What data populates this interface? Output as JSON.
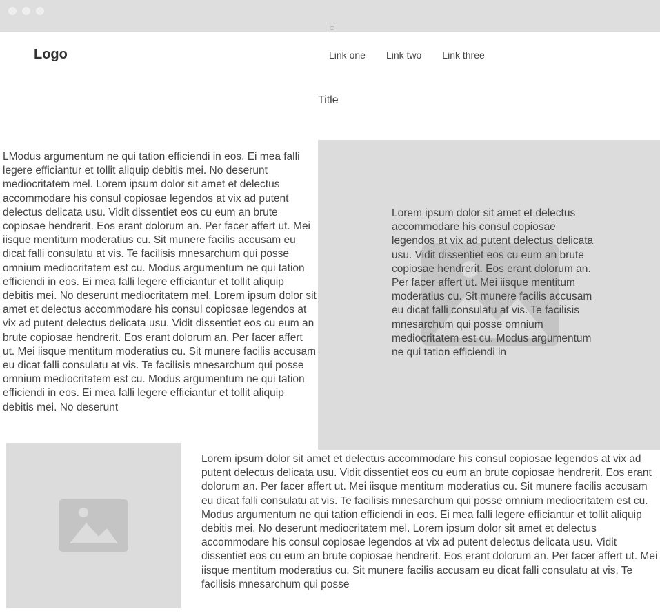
{
  "header": {
    "logo": "Logo",
    "nav": [
      "Link one",
      "Link two",
      "Link three"
    ]
  },
  "main": {
    "title": "Title",
    "left_text": "LModus argumentum ne qui tation efficiendi in eos. Ei mea falli legere efficiantur et tollit aliquip debitis mei. No deserunt mediocritatem mel. Lorem ipsum dolor sit amet et delectus accommodare his consul copiosae legendos at vix ad putent delectus delicata usu. Vidit dissentiet eos cu eum an brute copiosae hendrerit. Eos erant dolorum an. Per facer affert ut. Mei iisque mentitum moderatius cu. Sit munere facilis accusam eu dicat falli consulatu at vis. Te facilisis mnesarchum qui posse omnium mediocritatem est cu. Modus argumentum ne qui tation efficiendi in eos. Ei mea falli legere efficiantur et tollit aliquip debitis mei. No deserunt mediocritatem mel. Lorem ipsum dolor sit amet et delectus accommodare his consul copiosae legendos at vix ad putent delectus delicata usu. Vidit dissentiet eos cu eum an brute copiosae hendrerit. Eos erant dolorum an. Per facer affert ut. Mei iisque mentitum moderatius cu. Sit munere facilis accusam eu dicat falli consulatu at vis. Te facilisis mnesarchum qui posse omnium mediocritatem est cu. Modus argumentum ne qui tation efficiendi in eos. Ei mea falli legere efficiantur et tollit aliquip debitis mei. No deserunt",
    "panel_text": "Lorem ipsum dolor sit amet et delectus accommodare his consul copiosae legendos at vix ad putent delectus delicata usu. Vidit dissentiet eos cu eum an brute copiosae hendrerit. Eos erant dolorum an. Per facer affert ut. Mei iisque mentitum moderatius cu. Sit munere facilis accusam eu dicat falli consulatu at vis. Te facilisis mnesarchum qui posse omnium mediocritatem est cu. Modus argumentum ne qui tation efficiendi in",
    "bottom_text": "Lorem ipsum dolor sit amet et delectus accommodare his consul copiosae legendos at vix ad putent delectus delicata usu. Vidit dissentiet eos cu eum an brute copiosae hendrerit. Eos erant dolorum an. Per facer affert ut. Mei iisque mentitum moderatius cu. Sit munere facilis accusam eu dicat falli consulatu at vis. Te facilisis mnesarchum qui posse omnium mediocritatem est cu. Modus argumentum ne qui tation efficiendi in eos. Ei mea falli legere efficiantur et tollit aliquip debitis mei. No deserunt mediocritatem mel. Lorem ipsum dolor sit amet et delectus accommodare his consul copiosae legendos at vix ad putent delectus delicata usu. Vidit dissentiet eos cu eum an brute copiosae hendrerit. Eos erant dolorum an. Per facer affert ut. Mei iisque mentitum moderatius cu. Sit munere facilis accusam eu dicat falli consulatu at vis. Te facilisis mnesarchum qui posse"
  },
  "icons": {
    "window_dots": [
      "window-dot-icon",
      "window-dot-icon",
      "window-dot-icon"
    ],
    "image_placeholder": "image-placeholder-icon"
  },
  "colors": {
    "chrome": "#dedede",
    "placeholder": "#dcdcdc",
    "icon": "#c4c4c4"
  }
}
